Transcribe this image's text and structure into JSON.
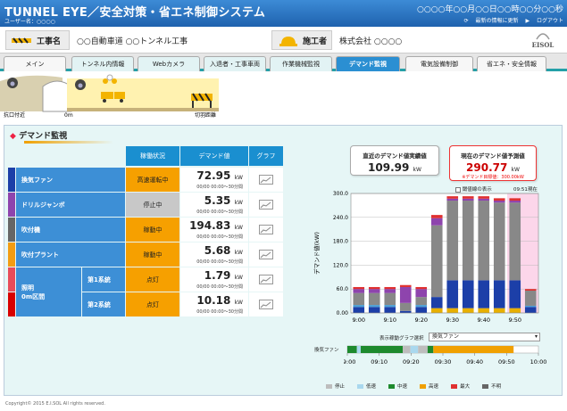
{
  "header": {
    "title": "TUNNEL EYE／安全対策・省エネ制御システム",
    "user": "ユーザー名：○○○○",
    "datetime": "○○○○年○○月○○日○○時○○分○○秒",
    "refresh": "最新の情報に更新",
    "logout": "ログアウト"
  },
  "info": {
    "project_label": "工事名",
    "project_value": "○○自動車道 ○○トンネル工事",
    "contractor_label": "施工者",
    "contractor_value": "株式会社 ○○○○",
    "logo": "EISOL"
  },
  "tabs": [
    "メイン",
    "トンネル内情報",
    "Webカメラ",
    "入退者・工事車両",
    "作業機械監視",
    "デマンド監視",
    "電気設備制御",
    "省エネ・安全情報"
  ],
  "tunnel": {
    "left_label": "抗口付近",
    "zero_label": "0m",
    "face_label": "切羽",
    "face_unit": "距離"
  },
  "section_title": "デマンド監視",
  "table": {
    "headers": [
      "稼働状況",
      "デマンド値",
      "グラフ"
    ],
    "unit": "kW",
    "sub_text": "00/00 00:00～30分間",
    "lighting_label": "照明",
    "lighting_sub": "0m区間",
    "rows": [
      {
        "name": "換気ファン",
        "status": "高速運転中",
        "value": "72.95",
        "color": "#1c3fa8",
        "state": "run"
      },
      {
        "name": "ドリルジャンボ",
        "status": "停止中",
        "value": "5.35",
        "color": "#8e44ad",
        "state": "stop"
      },
      {
        "name": "吹付機",
        "status": "稼動中",
        "value": "194.83",
        "color": "#666666",
        "state": "run"
      },
      {
        "name": "吹付プラント",
        "status": "稼動中",
        "value": "5.68",
        "color": "#f39c12",
        "state": "run"
      },
      {
        "name": "第1系統",
        "status": "点灯",
        "value": "1.79",
        "color": "#e84c5a",
        "state": "run"
      },
      {
        "name": "第2系統",
        "status": "点灯",
        "value": "10.18",
        "color": "#d80000",
        "state": "run"
      }
    ]
  },
  "summary": {
    "recent_label": "直近のデマンド値実績値",
    "recent_value": "109.99",
    "forecast_label": "現在のデマンド値予測値",
    "forecast_value": "290.77",
    "forecast_warn": "※デマンド目標値：300.00kW",
    "unit": "kW"
  },
  "chart_opts": {
    "checkbox_label": "閾値線の表示",
    "time_label": "09:51現在"
  },
  "chart_data": {
    "type": "bar",
    "stacked": true,
    "categories": [
      "9:00",
      "9:05",
      "9:10",
      "9:15",
      "9:20",
      "9:25",
      "9:30",
      "9:35",
      "9:40",
      "9:45",
      "9:50",
      "9:55"
    ],
    "x_tick_labels": [
      "9:00",
      "9:10",
      "9:20",
      "9:30",
      "9:40",
      "9:50"
    ],
    "ylabel": "デマンド値(kW)",
    "ylim": [
      0,
      300
    ],
    "y_ticks": [
      "0.00",
      "60.0",
      "120.0",
      "180.0",
      "240.0",
      "300.0"
    ],
    "series": [
      {
        "color": "#e8b000",
        "values": [
          0,
          0,
          0,
          0,
          0,
          12,
          12,
          12,
          12,
          12,
          12,
          0
        ]
      },
      {
        "color": "#1c3fa8",
        "values": [
          15,
          15,
          15,
          5,
          15,
          28,
          70,
          70,
          70,
          70,
          70,
          15
        ]
      },
      {
        "color": "#4a9fd6",
        "values": [
          5,
          5,
          5,
          0,
          5,
          0,
          0,
          0,
          0,
          0,
          0,
          3
        ]
      },
      {
        "color": "#888888",
        "values": [
          30,
          30,
          30,
          20,
          20,
          180,
          200,
          200,
          200,
          195,
          195,
          38
        ]
      },
      {
        "color": "#8e44ad",
        "values": [
          10,
          10,
          10,
          40,
          20,
          18,
          5,
          5,
          5,
          5,
          5,
          0
        ]
      },
      {
        "color": "#e03030",
        "values": [
          5,
          5,
          5,
          5,
          5,
          8,
          6,
          6,
          6,
          6,
          6,
          4
        ]
      }
    ],
    "forecast_shade_from": "9:50"
  },
  "timeline": {
    "select_label": "表示稼動グラフ選択",
    "select_value": "換気ファン",
    "row_label": "換気ファン",
    "x_ticks": [
      "09:00",
      "09:10",
      "09:20",
      "09:30",
      "09:40",
      "09:50",
      "10:00"
    ],
    "segments": [
      {
        "state": "中速",
        "from": 0,
        "to": 0.05
      },
      {
        "state": "低速",
        "from": 0.05,
        "to": 0.07
      },
      {
        "state": "中速",
        "from": 0.07,
        "to": 0.29
      },
      {
        "state": "停止",
        "from": 0.29,
        "to": 0.33
      },
      {
        "state": "低速",
        "from": 0.33,
        "to": 0.37
      },
      {
        "state": "停止",
        "from": 0.37,
        "to": 0.42
      },
      {
        "state": "中速",
        "from": 0.42,
        "to": 0.45
      },
      {
        "state": "高速",
        "from": 0.45,
        "to": 0.87
      }
    ],
    "legend": [
      {
        "label": "停止",
        "color": "#bdbdbd"
      },
      {
        "label": "低速",
        "color": "#a9d8ee"
      },
      {
        "label": "中速",
        "color": "#1e8a2e"
      },
      {
        "label": "高速",
        "color": "#f0a000"
      },
      {
        "label": "最大",
        "color": "#e03030"
      },
      {
        "label": "不明",
        "color": "#666666"
      }
    ]
  },
  "footer": "Copyright© 2015 E.I.SOL All rights reserved."
}
